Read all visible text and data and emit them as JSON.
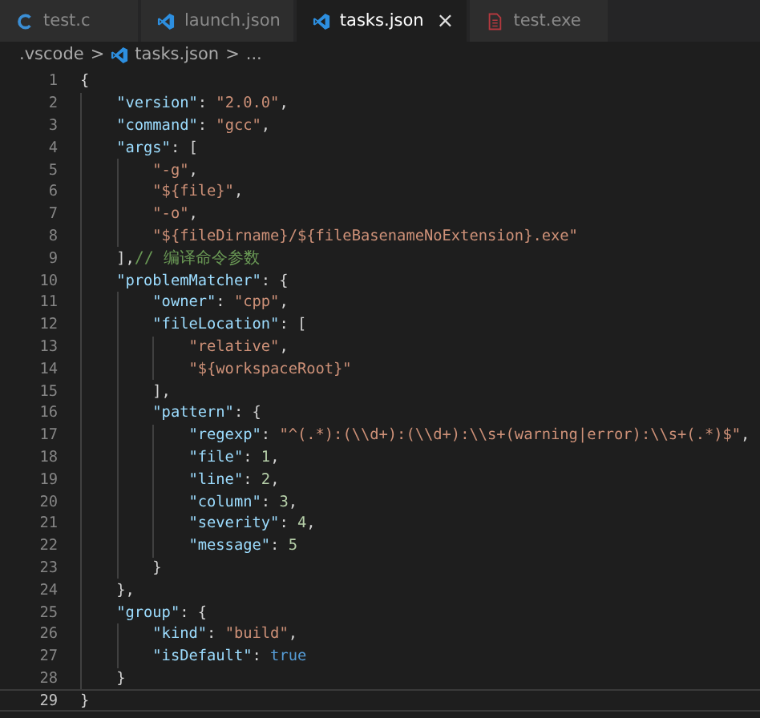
{
  "tabs": [
    {
      "label": "test.c",
      "kind": "c",
      "selected": false
    },
    {
      "label": "launch.json",
      "kind": "json",
      "selected": false
    },
    {
      "label": "tasks.json",
      "kind": "json",
      "selected": true,
      "close": "×"
    },
    {
      "label": "test.exe",
      "kind": "exe",
      "selected": false
    }
  ],
  "breadcrumb": [
    {
      "kind": "folder",
      "text": ".vscode"
    },
    {
      "kind": "sep",
      "text": ">"
    },
    {
      "kind": "file",
      "text": "tasks.json"
    },
    {
      "kind": "sep",
      "text": ">"
    },
    {
      "kind": "more",
      "text": "..."
    }
  ],
  "lines": [
    {
      "number": "1",
      "current": false,
      "tokens": [
        {
          "kind": "punct",
          "text": "{"
        }
      ]
    },
    {
      "number": "2",
      "current": false,
      "tokens": [
        {
          "kind": "key",
          "text": "    \"version\""
        },
        {
          "kind": "punct",
          "text": ": "
        },
        {
          "kind": "string",
          "text": "\"2.0.0\""
        },
        {
          "kind": "punct",
          "text": ","
        }
      ]
    },
    {
      "number": "3",
      "current": false,
      "tokens": [
        {
          "kind": "key",
          "text": "    \"command\""
        },
        {
          "kind": "punct",
          "text": ": "
        },
        {
          "kind": "string",
          "text": "\"gcc\""
        },
        {
          "kind": "punct",
          "text": ","
        }
      ]
    },
    {
      "number": "4",
      "current": false,
      "tokens": [
        {
          "kind": "key",
          "text": "    \"args\""
        },
        {
          "kind": "punct",
          "text": ": ["
        }
      ]
    },
    {
      "number": "5",
      "current": false,
      "tokens": [
        {
          "kind": "string",
          "text": "        \"-g\""
        },
        {
          "kind": "punct",
          "text": ","
        }
      ]
    },
    {
      "number": "6",
      "current": false,
      "tokens": [
        {
          "kind": "string",
          "text": "        \"${file}\""
        },
        {
          "kind": "punct",
          "text": ","
        }
      ]
    },
    {
      "number": "7",
      "current": false,
      "tokens": [
        {
          "kind": "string",
          "text": "        \"-o\""
        },
        {
          "kind": "punct",
          "text": ","
        }
      ]
    },
    {
      "number": "8",
      "current": false,
      "tokens": [
        {
          "kind": "string",
          "text": "        \"${fileDirname}/${fileBasenameNoExtension}.exe\""
        }
      ]
    },
    {
      "number": "9",
      "current": false,
      "tokens": [
        {
          "kind": "punct",
          "text": "    ],"
        },
        {
          "kind": "comment",
          "text": "// 编译命令参数"
        }
      ]
    },
    {
      "number": "10",
      "current": false,
      "tokens": [
        {
          "kind": "key",
          "text": "    \"problemMatcher\""
        },
        {
          "kind": "punct",
          "text": ": {"
        }
      ]
    },
    {
      "number": "11",
      "current": false,
      "tokens": [
        {
          "kind": "key",
          "text": "        \"owner\""
        },
        {
          "kind": "punct",
          "text": ": "
        },
        {
          "kind": "string",
          "text": "\"cpp\""
        },
        {
          "kind": "punct",
          "text": ","
        }
      ]
    },
    {
      "number": "12",
      "current": false,
      "tokens": [
        {
          "kind": "key",
          "text": "        \"fileLocation\""
        },
        {
          "kind": "punct",
          "text": ": ["
        }
      ]
    },
    {
      "number": "13",
      "current": false,
      "tokens": [
        {
          "kind": "string",
          "text": "            \"relative\""
        },
        {
          "kind": "punct",
          "text": ","
        }
      ]
    },
    {
      "number": "14",
      "current": false,
      "tokens": [
        {
          "kind": "string",
          "text": "            \"${workspaceRoot}\""
        }
      ]
    },
    {
      "number": "15",
      "current": false,
      "tokens": [
        {
          "kind": "punct",
          "text": "        ],"
        }
      ]
    },
    {
      "number": "16",
      "current": false,
      "tokens": [
        {
          "kind": "key",
          "text": "        \"pattern\""
        },
        {
          "kind": "punct",
          "text": ": {"
        }
      ]
    },
    {
      "number": "17",
      "current": false,
      "tokens": [
        {
          "kind": "key",
          "text": "            \"regexp\""
        },
        {
          "kind": "punct",
          "text": ": "
        },
        {
          "kind": "string",
          "text": "\"^(.*):(\\\\d+):(\\\\d+):\\\\s+(warning|error):\\\\s+(.*)$\""
        },
        {
          "kind": "punct",
          "text": ","
        }
      ]
    },
    {
      "number": "18",
      "current": false,
      "tokens": [
        {
          "kind": "key",
          "text": "            \"file\""
        },
        {
          "kind": "punct",
          "text": ": "
        },
        {
          "kind": "number",
          "text": "1"
        },
        {
          "kind": "punct",
          "text": ","
        }
      ]
    },
    {
      "number": "19",
      "current": false,
      "tokens": [
        {
          "kind": "key",
          "text": "            \"line\""
        },
        {
          "kind": "punct",
          "text": ": "
        },
        {
          "kind": "number",
          "text": "2"
        },
        {
          "kind": "punct",
          "text": ","
        }
      ]
    },
    {
      "number": "20",
      "current": false,
      "tokens": [
        {
          "kind": "key",
          "text": "            \"column\""
        },
        {
          "kind": "punct",
          "text": ": "
        },
        {
          "kind": "number",
          "text": "3"
        },
        {
          "kind": "punct",
          "text": ","
        }
      ]
    },
    {
      "number": "21",
      "current": false,
      "tokens": [
        {
          "kind": "key",
          "text": "            \"severity\""
        },
        {
          "kind": "punct",
          "text": ": "
        },
        {
          "kind": "number",
          "text": "4"
        },
        {
          "kind": "punct",
          "text": ","
        }
      ]
    },
    {
      "number": "22",
      "current": false,
      "tokens": [
        {
          "kind": "key",
          "text": "            \"message\""
        },
        {
          "kind": "punct",
          "text": ": "
        },
        {
          "kind": "number",
          "text": "5"
        }
      ]
    },
    {
      "number": "23",
      "current": false,
      "tokens": [
        {
          "kind": "punct",
          "text": "        }"
        }
      ]
    },
    {
      "number": "24",
      "current": false,
      "tokens": [
        {
          "kind": "punct",
          "text": "    },"
        }
      ]
    },
    {
      "number": "25",
      "current": false,
      "tokens": [
        {
          "kind": "key",
          "text": "    \"group\""
        },
        {
          "kind": "punct",
          "text": ": {"
        }
      ]
    },
    {
      "number": "26",
      "current": false,
      "tokens": [
        {
          "kind": "key",
          "text": "        \"kind\""
        },
        {
          "kind": "punct",
          "text": ": "
        },
        {
          "kind": "string",
          "text": "\"build\""
        },
        {
          "kind": "punct",
          "text": ","
        }
      ]
    },
    {
      "number": "27",
      "current": false,
      "tokens": [
        {
          "kind": "key",
          "text": "        \"isDefault\""
        },
        {
          "kind": "punct",
          "text": ": "
        },
        {
          "kind": "keyword",
          "text": "true"
        }
      ]
    },
    {
      "number": "28",
      "current": false,
      "tokens": [
        {
          "kind": "punct",
          "text": "    }"
        }
      ]
    },
    {
      "number": "29",
      "current": true,
      "tokens": [
        {
          "kind": "punct",
          "text": "}"
        }
      ]
    }
  ]
}
